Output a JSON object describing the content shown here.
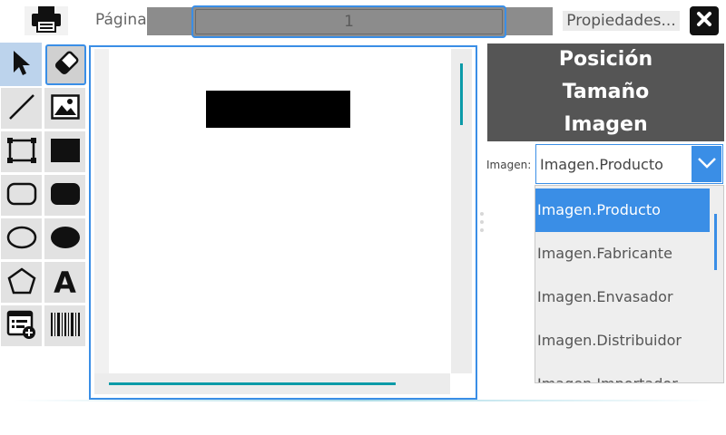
{
  "toolbar": {
    "print_icon": "printer-icon",
    "page_label": "Página",
    "page_value": "1",
    "properties_label": "Propiedades...",
    "close_icon": "close-icon"
  },
  "tools": [
    {
      "name": "pointer-tool",
      "icon": "pointer-icon"
    },
    {
      "name": "eraser-tool",
      "icon": "eraser-icon"
    },
    {
      "name": "line-tool",
      "icon": "line-icon"
    },
    {
      "name": "image-tool",
      "icon": "image-icon"
    },
    {
      "name": "rectangle-tool",
      "icon": "rectangle-outline-icon"
    },
    {
      "name": "filled-rectangle-tool",
      "icon": "rectangle-filled-icon"
    },
    {
      "name": "rounded-rectangle-tool",
      "icon": "rounded-rectangle-outline-icon"
    },
    {
      "name": "filled-rounded-rectangle-tool",
      "icon": "rounded-rectangle-filled-icon"
    },
    {
      "name": "ellipse-tool",
      "icon": "ellipse-outline-icon"
    },
    {
      "name": "filled-ellipse-tool",
      "icon": "ellipse-filled-icon"
    },
    {
      "name": "polygon-tool",
      "icon": "pentagon-icon"
    },
    {
      "name": "text-tool",
      "icon": "text-icon"
    },
    {
      "name": "add-field-tool",
      "icon": "list-add-icon"
    },
    {
      "name": "barcode-tool",
      "icon": "barcode-icon"
    }
  ],
  "text_tool_glyph": "A",
  "properties_panel": {
    "sections": [
      "Posición",
      "Tamaño",
      "Imagen"
    ]
  },
  "image_field": {
    "label": "Imagen:",
    "selected": "Imagen.Producto",
    "options": [
      "Imagen.Producto",
      "Imagen.Fabricante",
      "Imagen.Envasador",
      "Imagen.Distribuidor",
      "Imagen.Importador"
    ]
  },
  "colors": {
    "accent": "#3a8ee6",
    "scroll": "#0b9aa8",
    "panel": "#555555"
  }
}
